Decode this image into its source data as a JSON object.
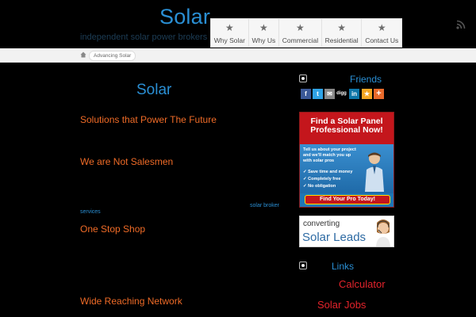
{
  "header": {
    "site_title": "Solar",
    "tagline": "independent solar power brokers",
    "nav": [
      {
        "label": "Why Solar",
        "icon": "star-icon"
      },
      {
        "label": "Why Us",
        "icon": "star-icon"
      },
      {
        "label": "Commercial",
        "icon": "star-icon"
      },
      {
        "label": "Residential",
        "icon": "star-icon"
      },
      {
        "label": "Contact Us",
        "icon": "star-icon"
      }
    ],
    "rss_icon": "rss-icon"
  },
  "breadcrumb": {
    "home_icon": "home-icon",
    "current": "Advancing Solar"
  },
  "main": {
    "title": "Solar",
    "headings": [
      "Solutions that Power The Future",
      "We are Not Salesmen",
      "One Stop Shop",
      "Wide Reaching Network"
    ],
    "inline_link_part1": "solar broker",
    "inline_link_part2": "services"
  },
  "sidebar": {
    "friends_title": "Friends",
    "share_buttons": [
      {
        "name": "facebook-icon",
        "glyph": "f",
        "color": "#3b5998"
      },
      {
        "name": "twitter-icon",
        "glyph": "t",
        "color": "#2fa3e6"
      },
      {
        "name": "email-icon",
        "glyph": "✉",
        "color": "#888888"
      },
      {
        "name": "digg-icon",
        "glyph": "digg",
        "color": "#000000"
      },
      {
        "name": "linkedin-icon",
        "glyph": "in",
        "color": "#0e76a8"
      },
      {
        "name": "favorite-icon",
        "glyph": "★",
        "color": "#f5a623"
      },
      {
        "name": "add-icon",
        "glyph": "+",
        "color": "#e86a2b"
      }
    ],
    "ad1": {
      "headline": "Find a Solar Panel Professional Now!",
      "body": "Tell us about your project and we'll match you up with solar pros",
      "bullets": [
        "✓ Save time and money",
        "✓ Completely free",
        "✓ No obligation"
      ],
      "cta": "Find Your Pro Today!"
    },
    "ad2": {
      "line1": "converting",
      "line2": "Solar Leads"
    },
    "links_title": "Links",
    "links": [
      "Calculator",
      "Solar Jobs"
    ]
  },
  "colors": {
    "accent_blue": "#2a8fd4",
    "heading_orange": "#ef6b27",
    "link_red": "#e4232b",
    "background": "#000000"
  }
}
